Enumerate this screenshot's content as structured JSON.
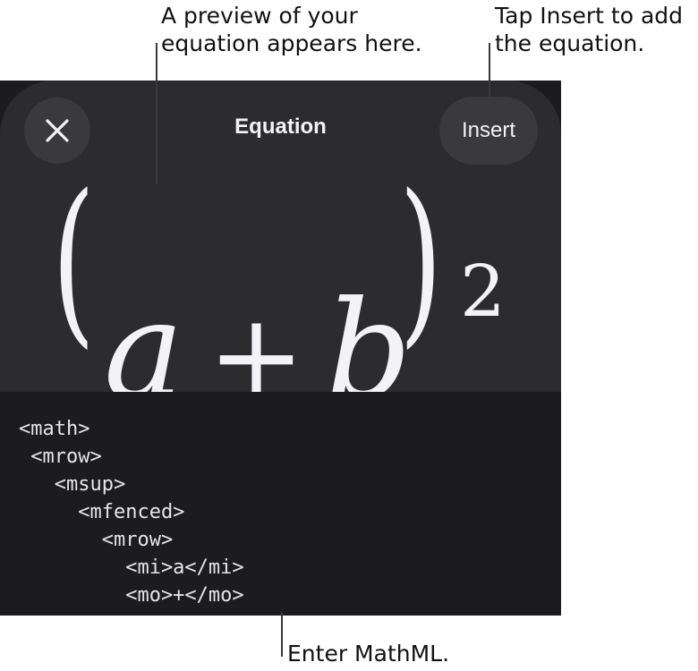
{
  "callouts": {
    "preview": "A preview of your\nequation appears here.",
    "insert": "Tap Insert to add\nthe equation.",
    "mathml": "Enter MathML."
  },
  "dialog": {
    "title": "Equation",
    "insert_label": "Insert",
    "close_icon": "close-icon"
  },
  "preview": {
    "open_paren": "(",
    "var_a": "a",
    "operator": "+",
    "var_b": "b",
    "close_paren": ")",
    "exponent": "2"
  },
  "editor": {
    "lines": [
      "<math>",
      " <mrow>",
      "   <msup>",
      "     <mfenced>",
      "       <mrow>",
      "         <mi>a</mi>",
      "         <mo>+</mo>"
    ]
  },
  "colors": {
    "panel": "#1c1c1e",
    "sheet": "#2c2c2e",
    "button": "#3a3a3c",
    "text": "#f2f2f7"
  }
}
